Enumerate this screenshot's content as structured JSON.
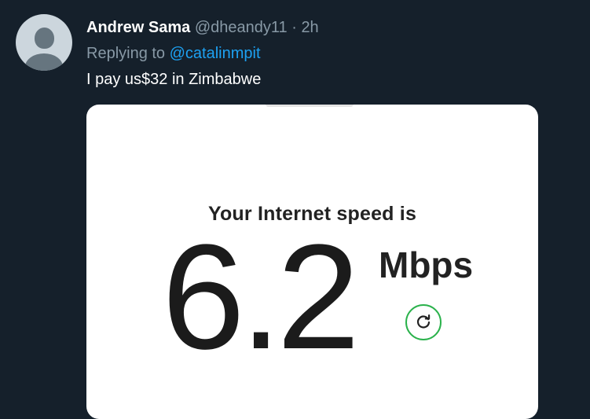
{
  "author": {
    "display_name": "Andrew Sama",
    "handle": "@dheandy11",
    "separator": "·",
    "time": "2h"
  },
  "reply": {
    "prefix": "Replying to",
    "mention": "@catalinmpit"
  },
  "tweet": {
    "text": "I pay us$32 in Zimbabwe"
  },
  "media": {
    "label": "Your Internet speed is",
    "speed_value": "6.2",
    "speed_unit": "Mbps",
    "refresh_icon": "refresh-icon"
  },
  "colors": {
    "background": "#15202b",
    "mention": "#1da1f2",
    "secondary_text": "#8899a6",
    "refresh_ring": "#2bb24c"
  }
}
